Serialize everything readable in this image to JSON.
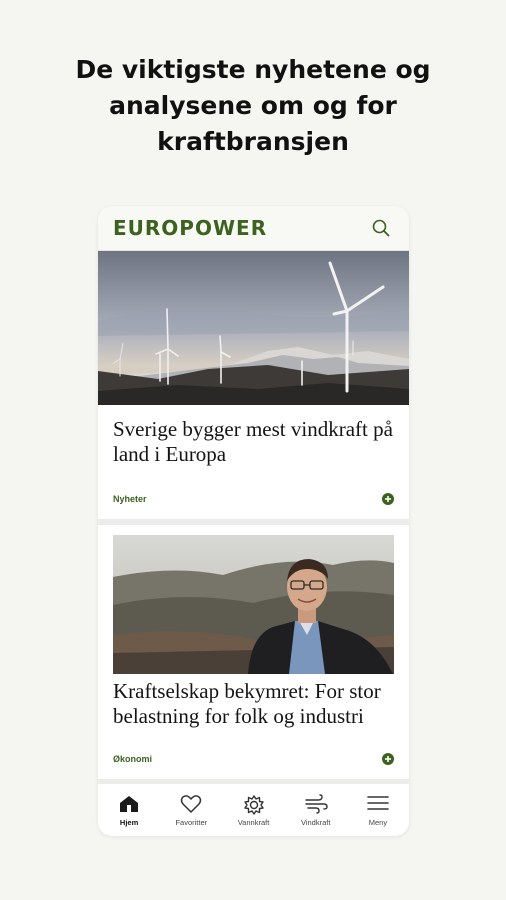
{
  "promo": {
    "line1": "De viktigste nyhetene og",
    "line2": "analysene om og for",
    "line3": "kraftbransjen"
  },
  "app": {
    "logo": "EUROPOWER",
    "brand_color": "#3c6220"
  },
  "articles": [
    {
      "title": "Sverige bygger mest vindkraft på land i Europa",
      "tag": "Nyheter",
      "image": "wind-turbines-photo"
    },
    {
      "title": "Kraftselskap bekymret: For stor belastning for folk og industri",
      "tag": "Økonomi",
      "image": "man-portrait-photo"
    }
  ],
  "nav": [
    {
      "label": "Hjem",
      "icon": "home-icon",
      "active": true
    },
    {
      "label": "Favoritter",
      "icon": "heart-icon",
      "active": false
    },
    {
      "label": "Vannkraft",
      "icon": "gear-icon",
      "active": false
    },
    {
      "label": "Vindkraft",
      "icon": "wind-icon",
      "active": false
    },
    {
      "label": "Meny",
      "icon": "menu-icon",
      "active": false
    }
  ]
}
